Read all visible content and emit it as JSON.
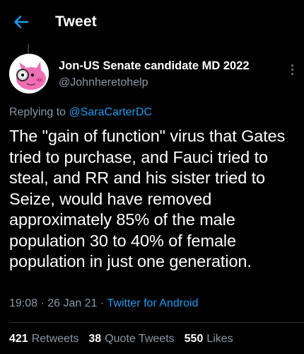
{
  "header": {
    "title": "Tweet",
    "back_icon": "arrow-left-icon",
    "accent_color": "#1d9bf0"
  },
  "author": {
    "display_name": "Jon-US Senate candidate MD 2022",
    "handle": "@Johnheretohelp",
    "avatar_icon": "pink-cartoon-pig-avatar"
  },
  "reply": {
    "prefix": "Replying to",
    "mention": "@SaraCarterDC"
  },
  "tweet": {
    "text": "The \"gain of function\" virus that Gates tried to purchase, and Fauci tried to steal, and RR and his sister tried to Seize, would have removed approximately 85% of the male population 30 to 40% of female population in just one generation."
  },
  "meta": {
    "time": "19:08",
    "separator": "·",
    "date": "26 Jan 21",
    "source": "Twitter for Android"
  },
  "stats": {
    "retweets_count": "421",
    "retweets_label": "Retweets",
    "quotes_count": "38",
    "quotes_label": "Quote Tweets",
    "likes_count": "550",
    "likes_label": "Likes"
  }
}
